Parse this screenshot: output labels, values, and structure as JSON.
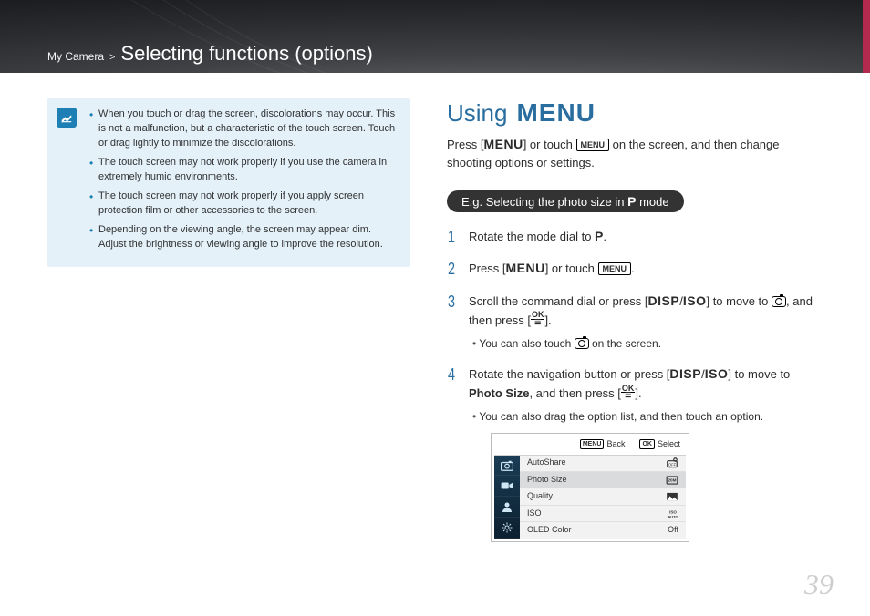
{
  "breadcrumb": {
    "parent": "My Camera",
    "sep": ">",
    "title": "Selecting functions (options)"
  },
  "notes": {
    "items": [
      "When you touch or drag the screen, discolorations may occur. This is not a malfunction, but a characteristic of the touch screen. Touch or drag lightly to minimize the discolorations.",
      "The touch screen may not work properly if you use the camera in extremely humid environments.",
      "The touch screen may not work properly if you apply screen protection film or other accessories to the screen.",
      "Depending on the viewing angle, the screen may appear dim. Adjust the brightness or viewing angle to improve the resolution."
    ]
  },
  "section": {
    "heading_prefix": "Using",
    "heading_menu": "MENU",
    "intro_a": "Press [",
    "intro_b": "] or touch ",
    "intro_c": " on the screen, and then change shooting options or settings.",
    "menu_button_label": "MENU"
  },
  "example": {
    "label_a": "E.g. Selecting the photo size in ",
    "label_mode": "P",
    "label_b": " mode"
  },
  "steps": {
    "s1": {
      "num": "1",
      "a": "Rotate the mode dial to ",
      "mode": "P",
      "b": "."
    },
    "s2": {
      "num": "2",
      "a": "Press [",
      "b": "] or touch ",
      "c": ".",
      "menu_label": "MENU"
    },
    "s3": {
      "num": "3",
      "a": "Scroll the command dial or press [",
      "disp": "DISP",
      "slash": "/",
      "iso": "ISO",
      "b": "] to move to ",
      "c": ", and then press [",
      "d": "].",
      "ok_top": "OK",
      "ok_bot": "☰",
      "sub": "You can also touch ",
      "sub_b": " on the screen."
    },
    "s4": {
      "num": "4",
      "a": "Rotate the navigation button or press [",
      "disp": "DISP",
      "slash": "/",
      "iso": "ISO",
      "b": "] to move to ",
      "target": "Photo Size",
      "c": ", and then press [",
      "d": "].",
      "ok_top": "OK",
      "ok_bot": "☰",
      "sub": "You can also drag the option list, and then touch an option."
    }
  },
  "lcd": {
    "bar": {
      "back_key": "MENU",
      "back": "Back",
      "select_key": "OK",
      "select": "Select"
    },
    "rows": {
      "r0": {
        "label": "AutoShare",
        "value_text": ""
      },
      "r1": {
        "label": "Photo Size",
        "value_text": ""
      },
      "r2": {
        "label": "Quality",
        "value_text": ""
      },
      "r3": {
        "label": "ISO",
        "value_text": ""
      },
      "r4": {
        "label": "OLED Color",
        "value_text": "Off"
      }
    }
  },
  "page_number": "39"
}
